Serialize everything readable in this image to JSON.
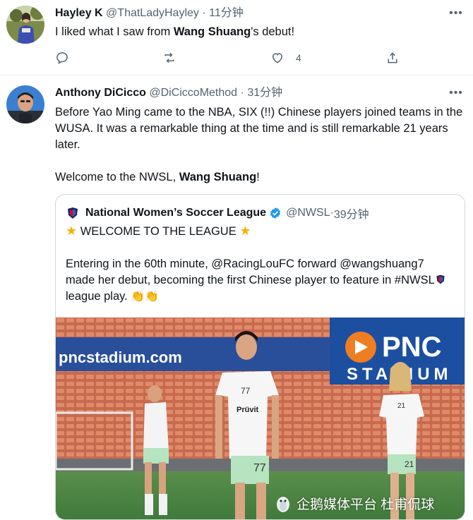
{
  "tweets": [
    {
      "name": "Hayley K",
      "handle": "@ThatLadyHayley",
      "time": "11分钟",
      "text_parts": [
        "I liked what I saw from ",
        "Wang Shuang",
        "'s debut!"
      ],
      "like_count": "4"
    },
    {
      "name": "Anthony DiCicco",
      "handle": "@DiCiccoMethod",
      "time": "31分钟",
      "para1": "Before Yao Ming came to the NBA, SIX (!!) Chinese players joined teams in the WUSA. It was a remarkable thing at the time and is still remarkable 21 years later.",
      "para2_parts": [
        "Welcome to the NWSL, ",
        "Wang Shuang",
        "!"
      ],
      "quote": {
        "name": "National Women’s Soccer League",
        "handle": "@NWSL",
        "time": "39分钟",
        "headline": "WELCOME TO THE LEAGUE",
        "body_part1": "Entering in the 60th minute, @RacingLouFC forward @wangshuang7 made her debut, becoming the first Chinese player to feature in #NWSL",
        "body_part2": " league play. ",
        "clap": "👏👏",
        "photo": {
          "banner_left": "pncstadium.com",
          "banner_right_1": "PNC",
          "banner_right_2": "STADIUM",
          "jersey_number_main": "77",
          "jersey_number_main_shorts": "77",
          "jersey_number_right": "21",
          "jersey_number_right_shorts": "21",
          "sponsor": "Prüvit"
        }
      }
    }
  ],
  "watermark": "企鹅媒体平台 杜甫侃球",
  "colors": {
    "text": "#0f1419",
    "secondary": "#536471",
    "border": "#cfd9de",
    "verified": "#1d9bf0",
    "star": "#f6b100"
  }
}
